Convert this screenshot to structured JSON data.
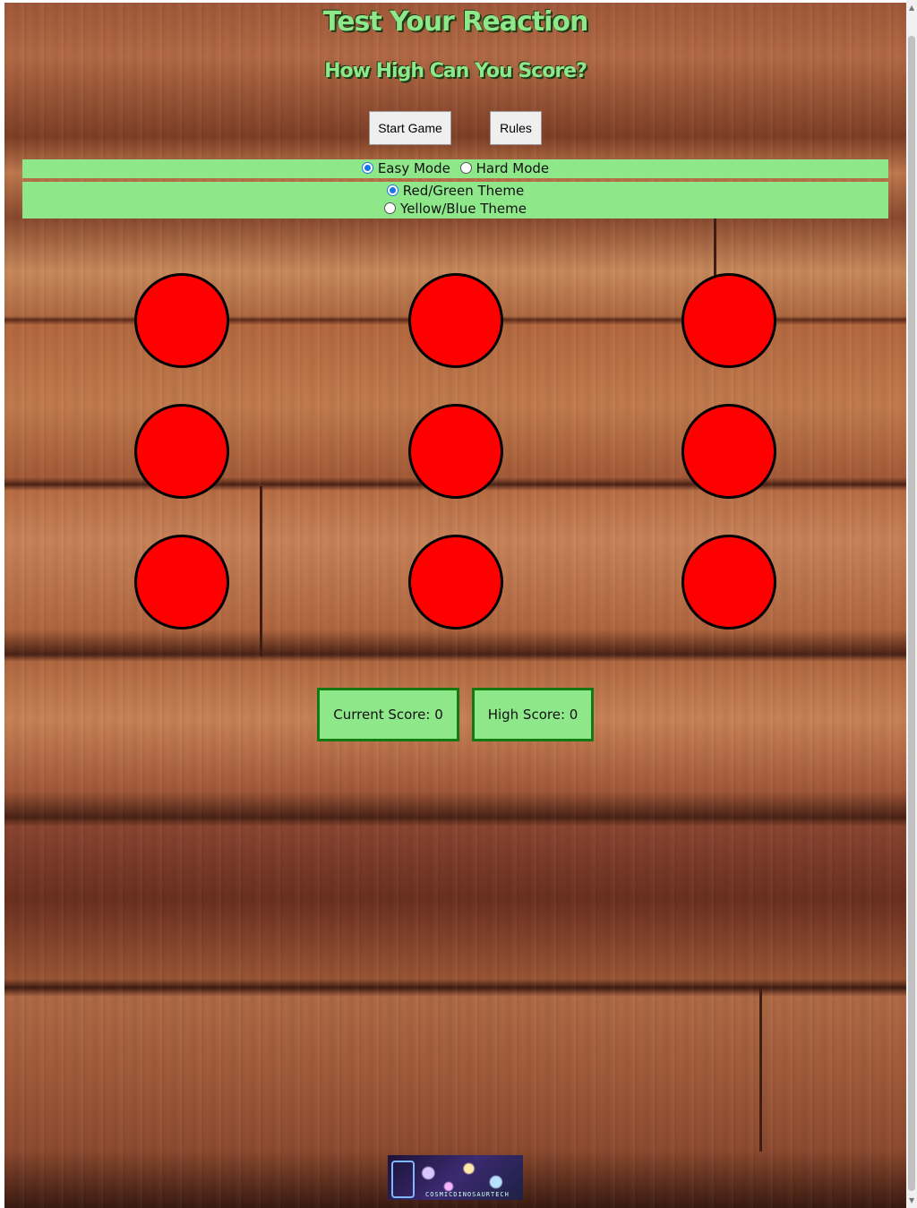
{
  "header": {
    "title": "Test Your Reaction",
    "subtitle": "How High Can You Score?"
  },
  "buttons": {
    "start_label": "Start Game",
    "rules_label": "Rules"
  },
  "mode": {
    "options": [
      "Easy Mode",
      "Hard Mode"
    ],
    "selected": "Easy Mode"
  },
  "theme": {
    "options": [
      "Red/Green Theme",
      "Yellow/Blue Theme"
    ],
    "selected": "Red/Green Theme"
  },
  "board": {
    "rows": 3,
    "cols": 3,
    "circle_color": "#ff0000"
  },
  "scores": {
    "current_label": "Current Score: 0",
    "high_label": "High Score: 0"
  },
  "footer": {
    "logo_text": "COSMICDINOSAURTECH"
  },
  "colors": {
    "accent_green": "#8ee88a",
    "border_green": "#137a12",
    "circle_red": "#ff0000"
  }
}
